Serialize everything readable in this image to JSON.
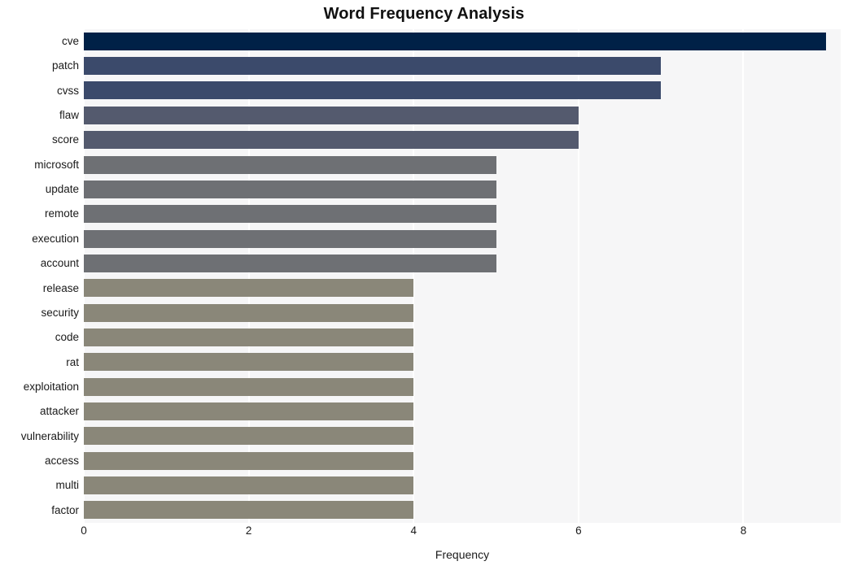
{
  "chart_data": {
    "type": "bar",
    "orientation": "horizontal",
    "title": "Word Frequency Analysis",
    "xlabel": "Frequency",
    "ylabel": "",
    "xlim": [
      0,
      9.18
    ],
    "xticks": [
      0,
      2,
      4,
      6,
      8
    ],
    "xtick_labels": [
      "0",
      "2",
      "4",
      "6",
      "8"
    ],
    "grid": "vertical-white-on-light-gray",
    "legend": "none",
    "categories": [
      "cve",
      "patch",
      "cvss",
      "flaw",
      "score",
      "microsoft",
      "update",
      "remote",
      "execution",
      "account",
      "release",
      "security",
      "code",
      "rat",
      "exploitation",
      "attacker",
      "vulnerability",
      "access",
      "multi",
      "factor"
    ],
    "values": [
      9,
      7,
      7,
      6,
      6,
      5,
      5,
      5,
      5,
      5,
      4,
      4,
      4,
      4,
      4,
      4,
      4,
      4,
      4,
      4
    ],
    "bar_colors": [
      "#002147",
      "#3b4a6b",
      "#3b4a6b",
      "#545a6e",
      "#545a6e",
      "#6e7074",
      "#6e7074",
      "#6e7074",
      "#6e7074",
      "#6e7074",
      "#8a8779",
      "#8a8779",
      "#8a8779",
      "#8a8779",
      "#8a8779",
      "#8a8779",
      "#8a8779",
      "#8a8779",
      "#8a8779",
      "#8a8779"
    ],
    "plot_background": "#f6f6f7",
    "gridline_color": "#ffffff",
    "figure_background": "#ffffff"
  }
}
